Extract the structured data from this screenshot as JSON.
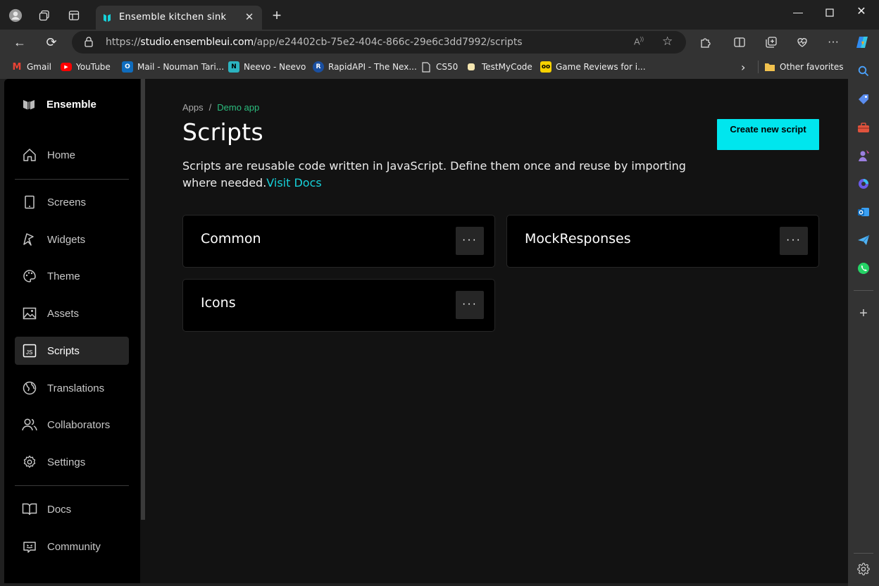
{
  "browser": {
    "tab_title": "Ensemble kitchen sink",
    "url_prefix": "https://",
    "url_host": "studio.ensembleui.com",
    "url_path": "/app/e24402cb-75e2-404c-866c-29e6c3dd7992/scripts",
    "bookmarks": [
      {
        "label": "Gmail",
        "icon": "gmail-icon",
        "color": "#ea4335"
      },
      {
        "label": "YouTube",
        "icon": "youtube-icon",
        "color": "#ff0000"
      },
      {
        "label": "Mail - Nouman Tari...",
        "icon": "outlook-icon",
        "color": "#0f6cbd"
      },
      {
        "label": "Neevo - Neevo",
        "icon": "neevo-icon",
        "color": "#2bb3c0"
      },
      {
        "label": "RapidAPI - The Nex...",
        "icon": "rapidapi-icon",
        "color": "#1a4fa0"
      },
      {
        "label": "CS50",
        "icon": "page-icon",
        "color": "#cccccc"
      },
      {
        "label": "TestMyCode",
        "icon": "testmycode-icon",
        "color": "#f5e6b0"
      },
      {
        "label": "Game Reviews for i...",
        "icon": "game-icon",
        "color": "#f6d100"
      }
    ],
    "other_favorites": "Other favorites"
  },
  "sidebar": {
    "brand": "Ensemble",
    "items": [
      {
        "label": "Home",
        "icon": "home-icon"
      },
      {
        "label": "Screens",
        "icon": "phone-icon"
      },
      {
        "label": "Widgets",
        "icon": "widgets-icon"
      },
      {
        "label": "Theme",
        "icon": "palette-icon"
      },
      {
        "label": "Assets",
        "icon": "image-icon"
      },
      {
        "label": "Scripts",
        "icon": "js-icon",
        "active": true
      },
      {
        "label": "Translations",
        "icon": "globe-icon"
      },
      {
        "label": "Collaborators",
        "icon": "users-icon"
      },
      {
        "label": "Settings",
        "icon": "gear-icon"
      },
      {
        "label": "Docs",
        "icon": "book-icon"
      },
      {
        "label": "Community",
        "icon": "discord-icon"
      }
    ]
  },
  "main": {
    "breadcrumb": {
      "root": "Apps",
      "separator": "/",
      "current": "Demo app"
    },
    "title": "Scripts",
    "description": "Scripts are reusable code written in JavaScript. Define them once and reuse by importing where needed.",
    "docs_link": "Visit Docs",
    "create_button": "Create new script",
    "scripts": [
      {
        "name": "Common"
      },
      {
        "name": "MockResponses"
      },
      {
        "name": "Icons"
      }
    ],
    "more_label": "···"
  },
  "colors": {
    "accent": "#00e6ee",
    "link": "#16d1d9",
    "breadcrumb_current": "#2bbd7e",
    "page_bg": "#121212",
    "sidebar_bg": "#000000"
  }
}
